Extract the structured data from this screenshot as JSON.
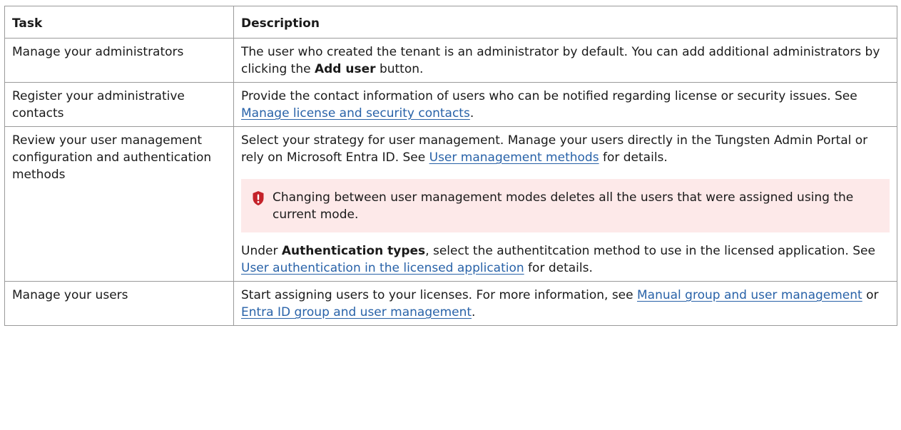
{
  "table": {
    "headers": {
      "task": "Task",
      "description": "Description"
    },
    "rows": [
      {
        "task": "Manage your administrators",
        "desc": {
          "t1": "The user who created the tenant is an administrator by default. You can add additional administrators by clicking the ",
          "bold": "Add user",
          "t2": " button."
        }
      },
      {
        "task": "Register your administrative contacts",
        "desc": {
          "t1": "Provide the contact information of users who can be notified regarding license or security issues. See ",
          "link": "Manage license and security contacts",
          "t2": "."
        }
      },
      {
        "task": "Review your user management configuration and authentication methods",
        "desc": {
          "t1": "Select your strategy for user management. Manage your users directly in the Tungsten Admin Portal or rely on Microsoft Entra ID. See ",
          "link": "User management methods",
          "t2": " for details.",
          "alert": "Changing between user management modes deletes all the users that were assigned using the current mode.",
          "t3": "Under ",
          "bold": "Authentication types",
          "t4": ", select the authentitcation method to use in the licensed application. See ",
          "link2": "User authentication in the licensed application",
          "t5": " for details."
        }
      },
      {
        "task": "Manage your users",
        "desc": {
          "t1": "Start assigning users to your licenses. For more information, see ",
          "link": "Manual group and user management",
          "t2": " or ",
          "link2": "Entra ID group and user management",
          "t3": "."
        }
      }
    ]
  },
  "colors": {
    "link": "#2862a8",
    "alert_bg": "#fde9e9",
    "alert_icon": "#c4222a",
    "border": "#9a9a9a"
  },
  "icons": {
    "alert": "exclamation-shield-icon"
  }
}
